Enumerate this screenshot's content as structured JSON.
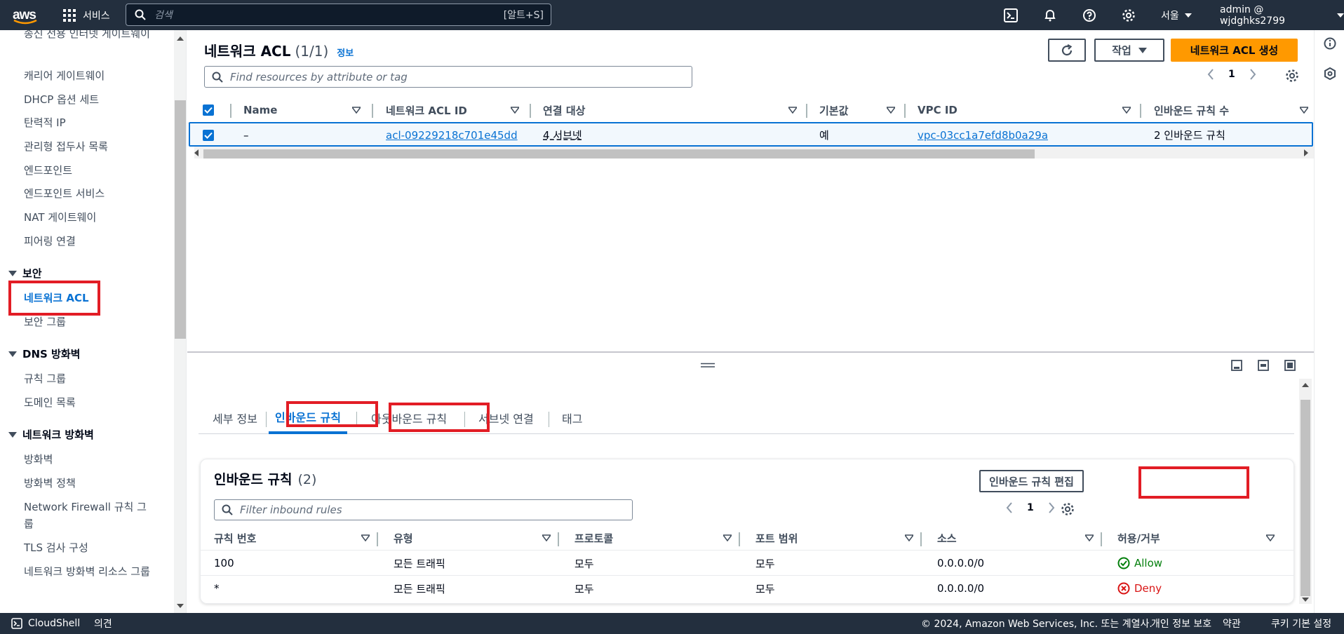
{
  "topnav": {
    "logo": "aws",
    "services": "서비스",
    "search_placeholder": "검색",
    "search_shortcut": "[알트+S]",
    "region": "서울",
    "account": "admin @ wjdghks2799"
  },
  "sidebar": {
    "items_top": [
      "송신 전용 인터넷 게이트웨이",
      "캐리어 게이트웨이",
      "DHCP 옵션 세트",
      "탄력적 IP",
      "관리형 접두사 목록",
      "엔드포인트",
      "엔드포인트 서비스",
      "NAT 게이트웨이",
      "피어링 연결"
    ],
    "sec_security": "보안",
    "item_nacl": "네트워크 ACL",
    "item_sg": "보안 그룹",
    "sec_dns": "DNS 방화벽",
    "item_rule_groups": "규칙 그룹",
    "item_domain_list": "도메인 목록",
    "sec_nfw": "네트워크 방화벽",
    "item_fw": "방화벽",
    "item_fw_policy": "방화벽 정책",
    "item_nfw_rule": "Network Firewall 규칙 그룹",
    "item_tls": "TLS 검사 구성",
    "item_nfw_res": "네트워크 방화벽 리소스 그룹"
  },
  "main": {
    "title": "네트워크 ACL",
    "count": "(1/1)",
    "info": "정보",
    "actions_label": "작업",
    "create_label": "네트워크 ACL 생성",
    "filter_placeholder": "Find resources by attribute or tag",
    "page": "1",
    "columns": [
      "Name",
      "네트워크 ACL ID",
      "연결 대상",
      "기본값",
      "VPC ID",
      "인바운드 규칙 수"
    ],
    "row": {
      "name": "–",
      "acl_id": "acl-09229218c701e45dd",
      "assoc": "4 서브넷",
      "default": "예",
      "vpc": "vpc-03cc1a7efd8b0a29a",
      "inbound": "2 인바운드 규칙"
    }
  },
  "details": {
    "tabs": [
      "세부 정보",
      "인바운드 규칙",
      "아웃바운드 규칙",
      "서브넷 연결",
      "태그"
    ],
    "panel_title": "인바운드 규칙",
    "panel_count": "(2)",
    "edit_label": "인바운드 규칙 편집",
    "filter_placeholder": "Filter inbound rules",
    "page": "1",
    "columns": [
      "규칙 번호",
      "유형",
      "프로토콜",
      "포트 범위",
      "소스",
      "허용/거부"
    ],
    "rules": [
      {
        "num": "100",
        "type": "모든 트래픽",
        "protocol": "모두",
        "port": "모두",
        "source": "0.0.0.0/0",
        "action": "Allow"
      },
      {
        "num": "*",
        "type": "모든 트래픽",
        "protocol": "모두",
        "port": "모두",
        "source": "0.0.0.0/0",
        "action": "Deny"
      }
    ]
  },
  "footer": {
    "cloudshell": "CloudShell",
    "feedback": "의견",
    "copyright": "© 2024, Amazon Web Services, Inc. 또는 계열사.",
    "privacy": "개인 정보 보호",
    "terms": "약관",
    "cookies": "쿠키 기본 설정"
  },
  "colors": {
    "nav": "#232f3e",
    "accent": "#0972d3",
    "primary": "#ff9900",
    "highlight": "#e21d25"
  }
}
